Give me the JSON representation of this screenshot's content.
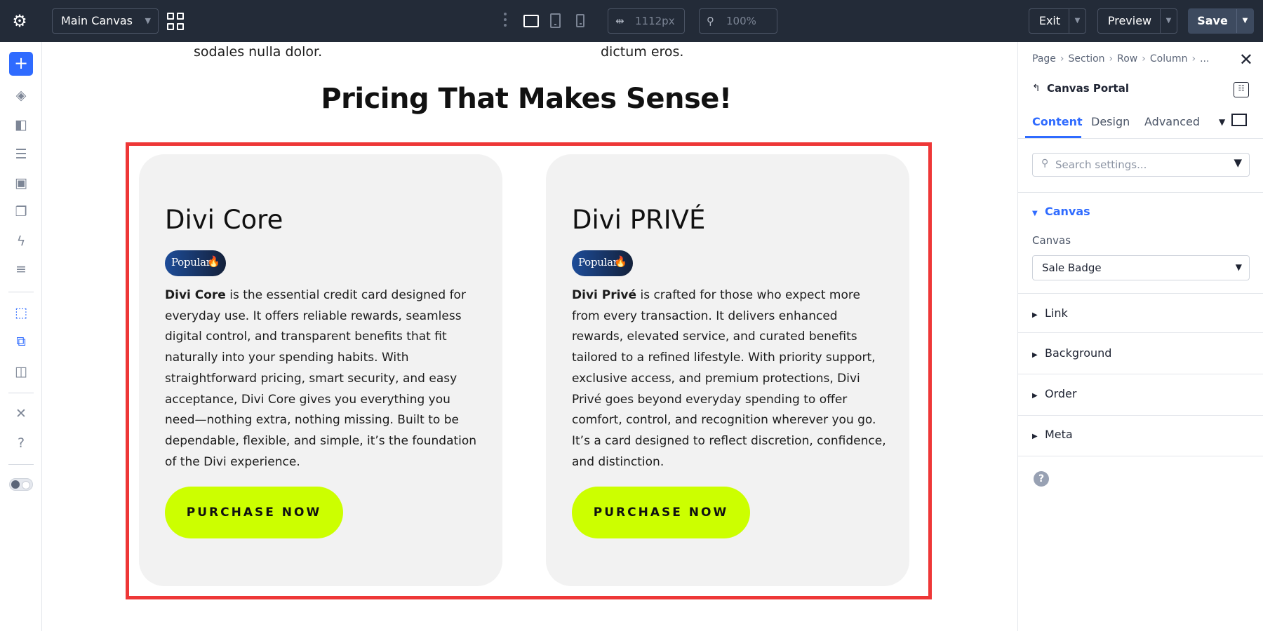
{
  "topbar": {
    "settings_icon": "gear-icon",
    "canvas_select": "Main Canvas",
    "width_value": "1112px",
    "zoom_value": "100%",
    "exit_label": "Exit",
    "preview_label": "Preview",
    "save_label": "Save"
  },
  "sidebar": {
    "icons": [
      "add-icon",
      "layers-icon",
      "theme-icon",
      "database-icon",
      "layout-icon",
      "pages-icon",
      "lightning-icon",
      "list-icon",
      "click-select-icon",
      "multi-select-icon",
      "template-eye-icon",
      "tools-icon",
      "help-icon",
      "mode-toggle"
    ]
  },
  "canvas": {
    "prev_text_left": "sodales nulla dolor.",
    "prev_text_right": "dictum eros.",
    "heading": "Pricing That Makes Sense!",
    "accent_color": "#ccff00",
    "outline_color": "#ee3737",
    "cards": [
      {
        "title": "Divi Core",
        "badge": "Popular",
        "body_bold": "Divi Core",
        "body": " is the essential credit card designed for everyday use. It offers reliable rewards, seamless digital control, and transparent benefits that fit naturally into your spending habits. With straightforward pricing, smart security, and easy acceptance, Divi Core gives you everything you need—nothing extra, nothing missing. Built to be dependable, flexible, and simple, it’s the foundation of the Divi experience.",
        "button": "PURCHASE NOW"
      },
      {
        "title": "Divi PRIVÉ",
        "badge": "Popular",
        "body_bold": "Divi Privé",
        "body": " is crafted for those who expect more from every transaction. It delivers enhanced rewards, elevated service, and curated benefits tailored to a refined lifestyle. With priority support, exclusive access, and premium protections, Divi Privé goes beyond everyday spending to offer comfort, control, and recognition wherever you go. It’s a card designed to reflect discretion, confidence, and distinction.",
        "button": "PURCHASE NOW"
      }
    ]
  },
  "panel": {
    "breadcrumb": [
      "Page",
      "Section",
      "Row",
      "Column",
      "..."
    ],
    "module_title": "Canvas Portal",
    "tabs": [
      "Content",
      "Design",
      "Advanced"
    ],
    "search_placeholder": "Search settings...",
    "groups": {
      "canvas": "Canvas",
      "link": "Link",
      "background": "Background",
      "order": "Order",
      "meta": "Meta"
    },
    "canvas_field_label": "Canvas",
    "canvas_field_value": "Sale Badge"
  }
}
